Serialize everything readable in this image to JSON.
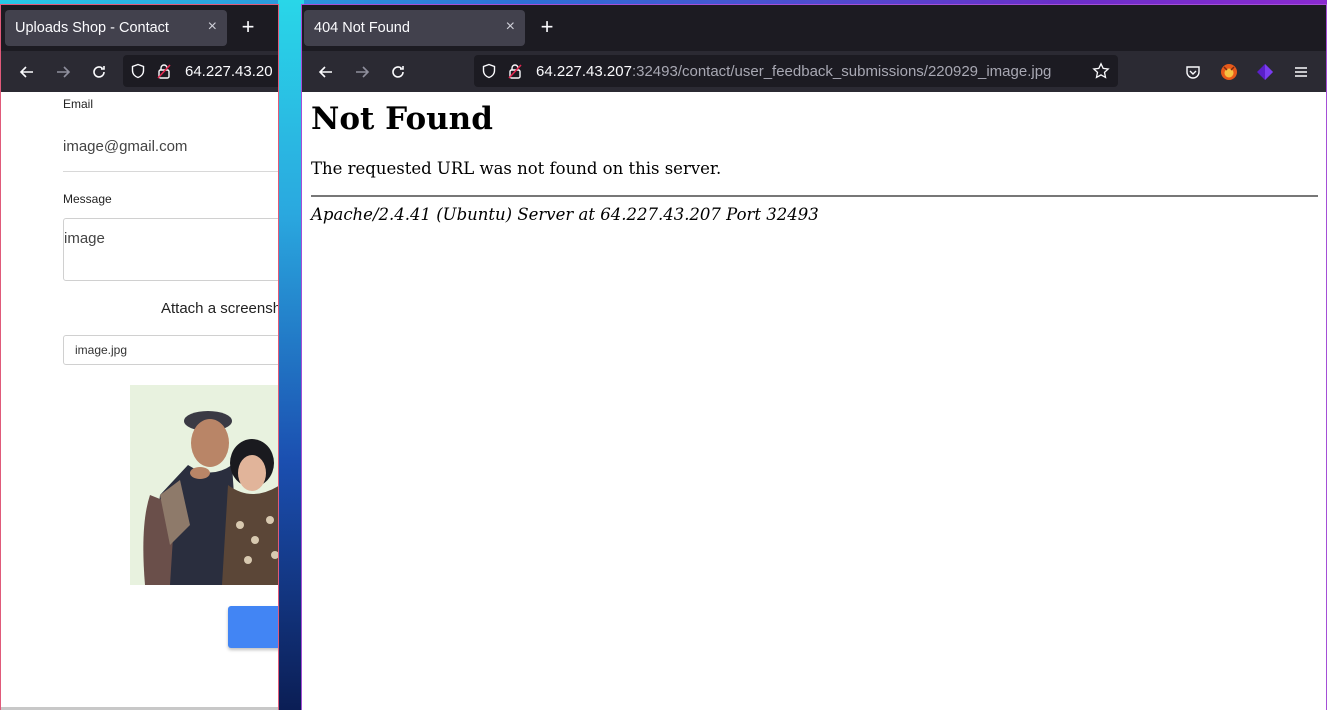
{
  "left_window": {
    "tab_title": "Uploads Shop - Contact",
    "url_host": "64.227.43.20",
    "form": {
      "email_label": "Email",
      "email_value": "image@gmail.com",
      "message_label": "Message",
      "message_value": "image",
      "attach_label": "Attach a screensh",
      "file_value": "image.jpg"
    }
  },
  "right_window": {
    "tab_title": "404 Not Found",
    "url_host": "64.227.43.207",
    "url_path": ":32493/contact/user_feedback_submissions/220929_image.jpg",
    "page": {
      "heading": "Not Found",
      "message": "The requested URL was not found on this server.",
      "server_signature": "Apache/2.4.41 (Ubuntu) Server at 64.227.43.207 Port 32493"
    }
  },
  "icons": {
    "close": "×",
    "new_tab": "+",
    "menu": "≡"
  },
  "colors": {
    "submit_button": "#4285f4",
    "left_border": "#e05a7a",
    "right_border": "#a44fd6"
  }
}
